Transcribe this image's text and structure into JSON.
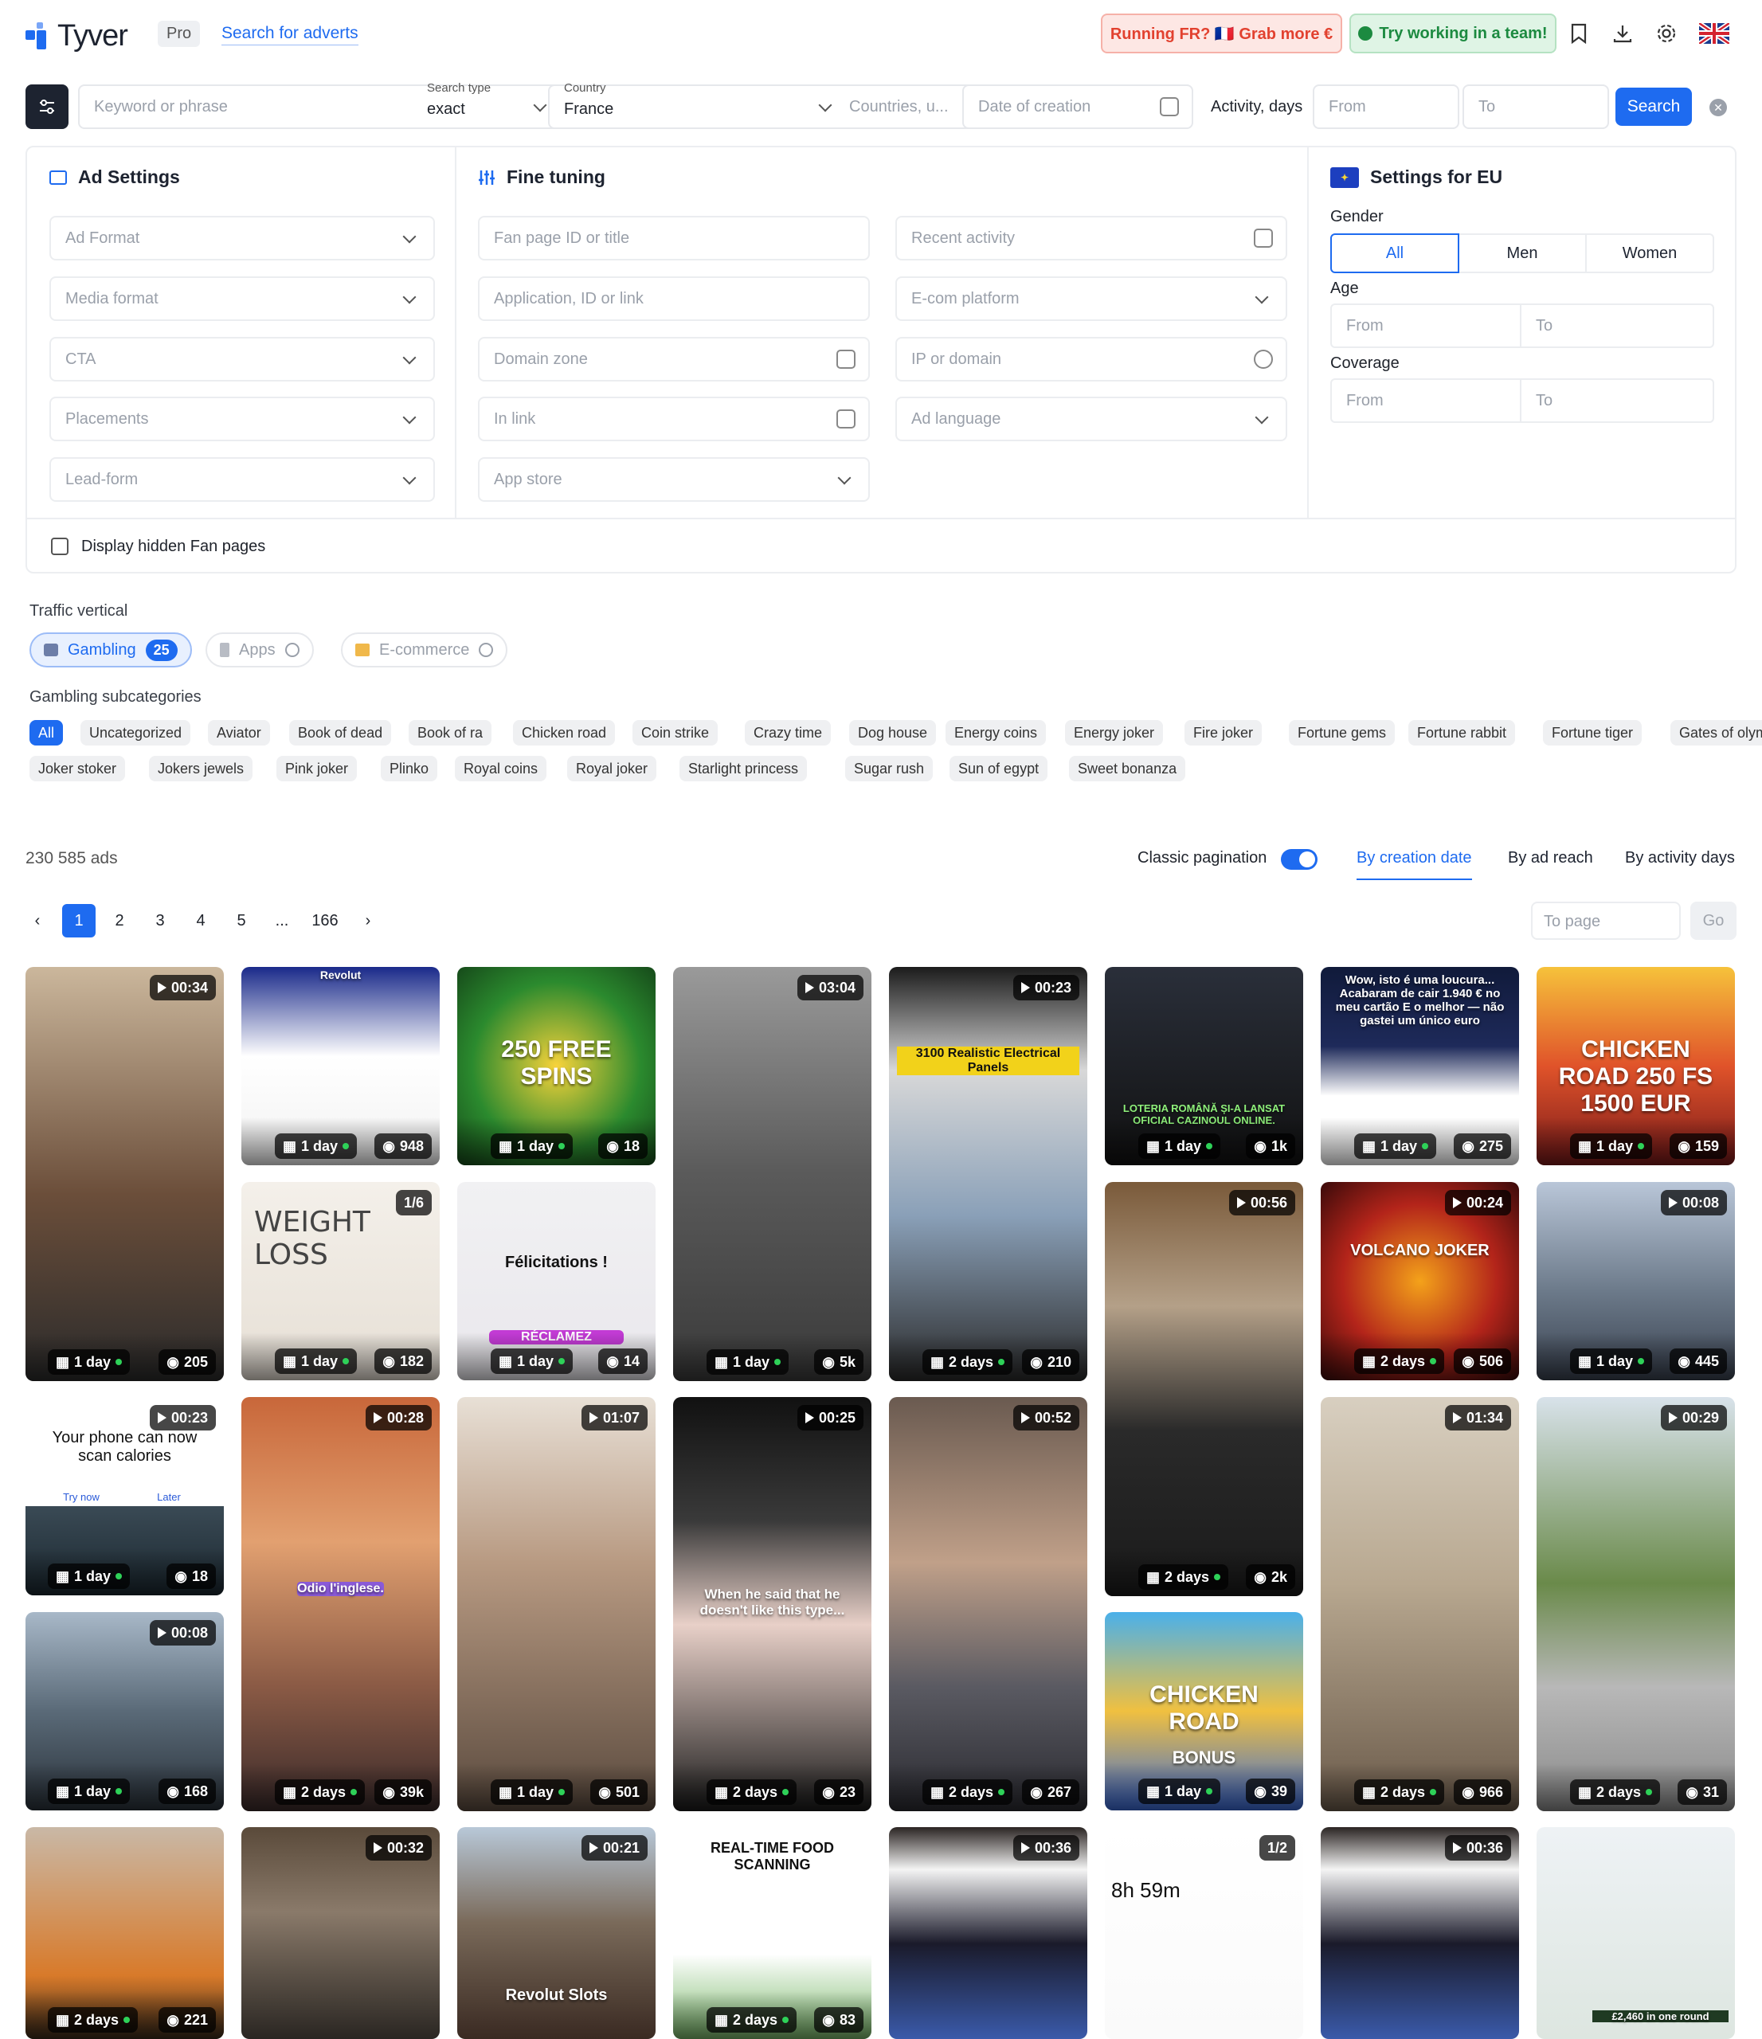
{
  "header": {
    "logo": "Tyver",
    "plan": "Pro",
    "search_link": "Search for adverts",
    "promo_fr": "Running FR? 🇫🇷 Grab more €",
    "promo_team": "Try working in a team!",
    "icons": [
      "bookmark-icon",
      "download-icon",
      "gear-icon",
      "uk-flag-icon"
    ]
  },
  "search": {
    "keyword_placeholder": "Keyword or phrase",
    "type_label": "Search type",
    "type_value": "exact",
    "country_label": "Country",
    "country_value": "France",
    "countries_placeholder": "Countries, u...",
    "date_placeholder": "Date of creation",
    "activity_label": "Activity, days",
    "from_placeholder": "From",
    "to_placeholder": "To",
    "button": "Search"
  },
  "ad_settings": {
    "title": "Ad Settings",
    "fields": [
      "Ad Format",
      "Media format",
      "CTA",
      "Placements",
      "Lead-form"
    ]
  },
  "fine_tuning": {
    "title": "Fine tuning",
    "left": [
      "Fan page ID or title",
      "Application, ID or link",
      "Domain zone",
      "In link",
      "App store"
    ],
    "right": [
      "Recent activity",
      "E-com platform",
      "IP or domain",
      "Ad language"
    ]
  },
  "eu": {
    "title": "Settings for EU",
    "gender_label": "Gender",
    "gender": [
      "All",
      "Men",
      "Women"
    ],
    "age_label": "Age",
    "coverage_label": "Coverage",
    "from": "From",
    "to": "To"
  },
  "hidden_fanpages": "Display hidden Fan pages",
  "traffic": {
    "label": "Traffic vertical",
    "gambling": "Gambling",
    "gambling_count": "25",
    "apps": "Apps",
    "ecom": "E-commerce"
  },
  "subcategories": {
    "label": "Gambling subcategories",
    "row1": [
      "All",
      "Uncategorized",
      "Aviator",
      "Book of dead",
      "Book of ra",
      "Chicken road",
      "Coin strike",
      "Crazy time",
      "Dog house",
      "Energy coins",
      "Energy joker",
      "Fire joker",
      "Fortune gems",
      "Fortune rabbit",
      "Fortune tiger",
      "Gates of olympus"
    ],
    "row2": [
      "Joker stoker",
      "Jokers jewels",
      "Pink joker",
      "Plinko",
      "Royal coins",
      "Royal joker",
      "Starlight princess",
      "Sugar rush",
      "Sun of egypt",
      "Sweet bonanza"
    ]
  },
  "results": {
    "count": "230 585 ads",
    "classic_pagination": "Classic pagination",
    "sort": [
      "By creation date",
      "By ad reach",
      "By activity days"
    ],
    "pages": [
      "1",
      "2",
      "3",
      "4",
      "5",
      "...",
      "166"
    ],
    "to_page": "To page",
    "go": "Go"
  },
  "cards": [
    {
      "dur": "00:34",
      "age": "1 day",
      "views": "205"
    },
    {
      "dur": "",
      "age": "1 day",
      "views": "948",
      "text": "Revolut"
    },
    {
      "dur": "",
      "age": "1 day",
      "views": "18",
      "text": "250 FREE SPINS"
    },
    {
      "dur": "03:04",
      "age": "1 day",
      "views": "5k"
    },
    {
      "dur": "00:23",
      "age": "2 days",
      "views": "210",
      "text": "3100 Realistic Electrical Panels"
    },
    {
      "dur": "",
      "age": "1 day",
      "views": "1k",
      "text": "LOTERIA ROMÂNĂ ȘI-A LANSAT OFICIAL CAZINOUL ONLINE."
    },
    {
      "dur": "",
      "age": "1 day",
      "views": "275",
      "text": "Wow, isto é uma loucura... Acabaram de cair 1.940 € no meu cartão E o melhor — não gastei um único euro"
    },
    {
      "dur": "",
      "age": "1 day",
      "views": "159",
      "text": "CHICKEN ROAD 250 FS 1500 EUR"
    },
    {
      "dur": "1/6",
      "age": "1 day",
      "views": "182",
      "text": "WEIGHT LOSS"
    },
    {
      "dur": "",
      "age": "1 day",
      "views": "14",
      "text": "Félicitations !",
      "cta": "RÉCLAMEZ"
    },
    {
      "dur": "00:56",
      "age": "2 days",
      "views": "2k"
    },
    {
      "dur": "00:24",
      "age": "2 days",
      "views": "506",
      "text": "VOLCANO JOKER"
    },
    {
      "dur": "00:08",
      "age": "1 day",
      "views": "445"
    },
    {
      "dur": "00:23",
      "age": "1 day",
      "views": "18",
      "text": "Your phone can now scan calories",
      "opt1": "Try now",
      "opt2": "Later"
    },
    {
      "dur": "00:28",
      "age": "2 days",
      "views": "39k",
      "text": "Odio l'inglese."
    },
    {
      "dur": "01:07",
      "age": "1 day",
      "views": "501"
    },
    {
      "dur": "00:25",
      "age": "2 days",
      "views": "23",
      "text": "When he said that he doesn't like this type..."
    },
    {
      "dur": "00:52",
      "age": "2 days",
      "views": "267"
    },
    {
      "dur": "01:34",
      "age": "2 days",
      "views": "966"
    },
    {
      "dur": "00:29",
      "age": "2 days",
      "views": "31"
    },
    {
      "dur": "00:08",
      "age": "1 day",
      "views": "168"
    },
    {
      "dur": "",
      "age": "1 day",
      "views": "39",
      "text": "CHICKEN ROAD",
      "sub": "BONUS"
    },
    {
      "dur": "",
      "age": "2 days",
      "views": "221"
    },
    {
      "dur": "00:32",
      "age": "",
      "views": ""
    },
    {
      "dur": "00:21",
      "age": "",
      "views": "",
      "text": "Revolut Slots"
    },
    {
      "dur": "",
      "age": "2 days",
      "views": "83",
      "text": "REAL-TIME FOOD SCANNING"
    },
    {
      "dur": "00:36",
      "age": "",
      "views": ""
    },
    {
      "dur": "1/2",
      "age": "",
      "views": "",
      "text": "8h 59m"
    },
    {
      "dur": "00:36",
      "age": "",
      "views": ""
    },
    {
      "dur": "",
      "age": "",
      "views": "",
      "text": "£2,460 in one round"
    }
  ]
}
